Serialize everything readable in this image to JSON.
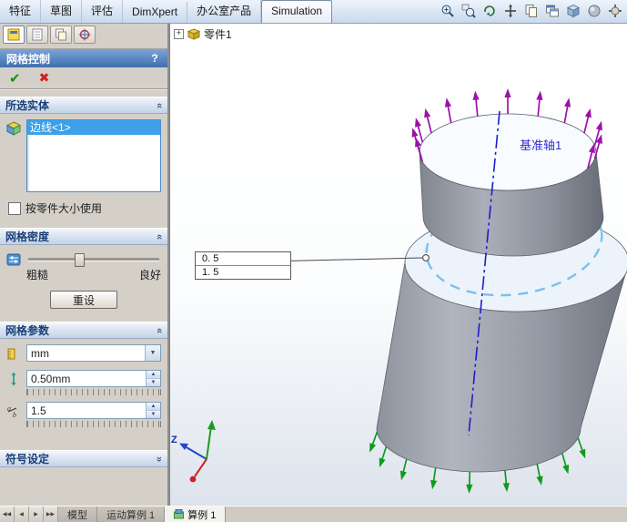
{
  "menu": {
    "tabs": [
      "特征",
      "草图",
      "评估",
      "DimXpert",
      "办公室产品",
      "Simulation"
    ],
    "active": "Simulation"
  },
  "pm": {
    "title": "网格控制",
    "help": "?",
    "groups": {
      "entities": {
        "title": "所选实体",
        "items": [
          "边线<1>"
        ],
        "checkbox": "按零件大小使用"
      },
      "density": {
        "title": "网格密度",
        "coarse": "粗糙",
        "fine": "良好",
        "reset": "重设"
      },
      "params": {
        "title": "网格参数",
        "unit": "mm",
        "size": "0.50mm",
        "ratio": "1.5"
      },
      "symbols": {
        "title": "符号设定"
      }
    }
  },
  "viewport": {
    "tree_item": "零件1",
    "axis_label": "基准轴1",
    "callout": [
      "0. 5",
      "1. 5"
    ],
    "triad_z": "Z"
  },
  "bottom": {
    "tabs": [
      "模型",
      "运动算例 1",
      "算例 1"
    ],
    "active": "算例 1"
  },
  "icons": {
    "check": "✔",
    "cross": "✖",
    "chevron": "«",
    "dropdown": "▼",
    "spin_up": "▲",
    "spin_down": "▼",
    "plus": "+",
    "nav_first": "◀◀",
    "nav_prev": "◀",
    "nav_next": "▶",
    "nav_last": "▶▶"
  }
}
